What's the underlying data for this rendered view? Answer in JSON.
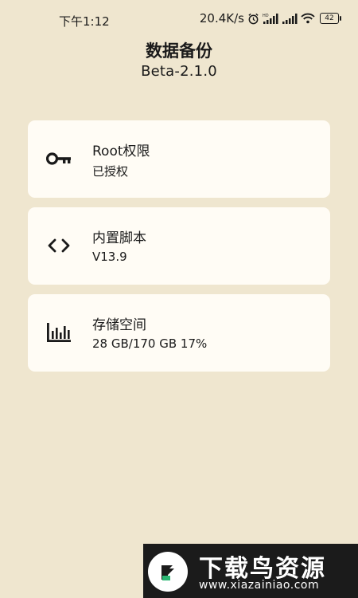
{
  "status_bar": {
    "time": "下午1:12",
    "network_speed": "20.4K/s",
    "battery": "42",
    "icons": [
      "alarm-icon",
      "hd-signal-icon",
      "signal-icon",
      "wifi-icon",
      "battery-icon"
    ]
  },
  "header": {
    "title": "数据备份",
    "version": "Beta-2.1.0"
  },
  "cards": [
    {
      "icon": "key-icon",
      "title": "Root权限",
      "subtitle": "已授权"
    },
    {
      "icon": "code-icon",
      "title": "内置脚本",
      "subtitle": "V13.9"
    },
    {
      "icon": "bar-chart-icon",
      "title": "存储空间",
      "subtitle": "28 GB/170 GB 17%"
    }
  ],
  "watermark": {
    "text": "下载鸟资源",
    "url": "www.xiazainiao.com"
  }
}
